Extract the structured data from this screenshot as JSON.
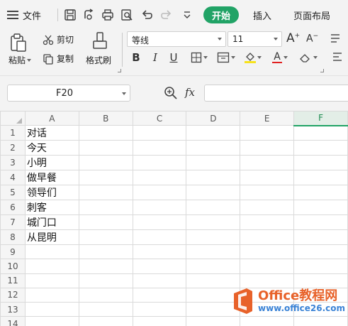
{
  "toolbar": {
    "file_label": "文件",
    "tabs": [
      {
        "label": "开始"
      },
      {
        "label": "插入"
      },
      {
        "label": "页面布局"
      }
    ]
  },
  "ribbon": {
    "paste_label": "粘贴",
    "cut_label": "剪切",
    "copy_label": "复制",
    "format_painter_label": "格式刷",
    "font_name": "等线",
    "font_size": "11",
    "bold_label": "B",
    "italic_label": "I",
    "underline_label": "U",
    "font_color_label": "A",
    "font_color": "#e02020",
    "fill_color": "#f7e21b",
    "increase_font_label": "A",
    "decrease_font_label": "A"
  },
  "formula_bar": {
    "cell_ref": "F20",
    "fx_label": "fx",
    "formula_value": ""
  },
  "sheet": {
    "columns": [
      "A",
      "B",
      "C",
      "D",
      "E",
      "F"
    ],
    "active_column": "F",
    "rows": [
      {
        "num": "1",
        "A": "对话"
      },
      {
        "num": "2",
        "A": "今天"
      },
      {
        "num": "3",
        "A": "小明"
      },
      {
        "num": "4",
        "A": "做早餐"
      },
      {
        "num": "5",
        "A": "领导们"
      },
      {
        "num": "6",
        "A": "刺客"
      },
      {
        "num": "7",
        "A": "城门口"
      },
      {
        "num": "8",
        "A": "从昆明"
      },
      {
        "num": "9",
        "A": ""
      },
      {
        "num": "10",
        "A": ""
      },
      {
        "num": "11",
        "A": ""
      },
      {
        "num": "12",
        "A": ""
      },
      {
        "num": "13",
        "A": ""
      },
      {
        "num": "14",
        "A": ""
      }
    ]
  },
  "watermark": {
    "title": "Office教程网",
    "url": "www.office26.com"
  },
  "colors": {
    "accent": "#21a366",
    "watermark_orange": "#e8622a",
    "watermark_blue": "#3b83d6"
  }
}
